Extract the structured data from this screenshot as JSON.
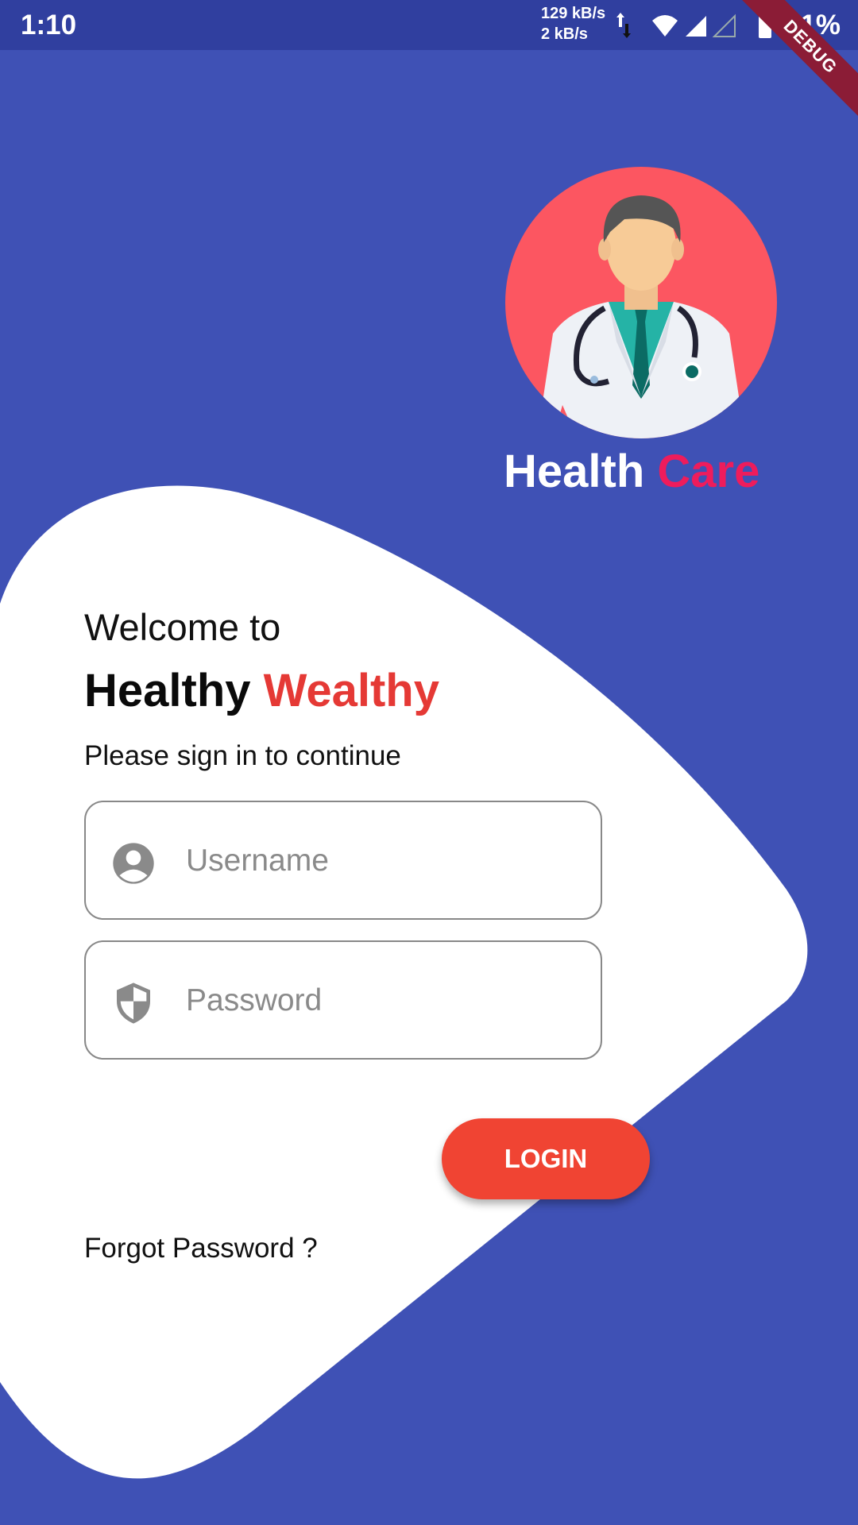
{
  "status_bar": {
    "time": "1:10",
    "net_up": "129 kB/s",
    "net_down": "2 kB/s",
    "battery": "51%",
    "debug_label": "DEBUG",
    "icons": [
      "data-transfer-icon",
      "wifi-icon",
      "signal-icon",
      "signal-empty-icon",
      "battery-icon"
    ]
  },
  "brand": {
    "word1": "Health",
    "word2": "Care",
    "word2_color": "#ee1c5c"
  },
  "welcome": {
    "line1": "Welcome to",
    "title_word1": "Healthy",
    "title_word2": "Wealthy",
    "title_word2_color": "#e53935",
    "subtitle": "Please sign in to continue"
  },
  "form": {
    "username_placeholder": "Username",
    "username_value": "",
    "password_placeholder": "Password",
    "password_value": "",
    "login_label": "LOGIN",
    "forgot_label": "Forgot Password ?"
  },
  "colors": {
    "background": "#3f51b5",
    "status_bar": "#303f9f",
    "accent": "#f04433"
  }
}
